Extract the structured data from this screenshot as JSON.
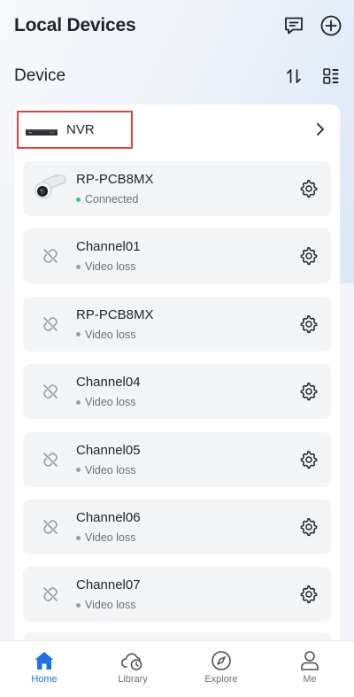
{
  "header": {
    "title": "Local Devices",
    "message_icon": "message-icon",
    "add_icon": "plus-circle-icon"
  },
  "section": {
    "title": "Device",
    "sort_icon": "sort-icon",
    "grid_icon": "grid-view-icon"
  },
  "nvr": {
    "name": "NVR",
    "icon": "nvr-device-icon",
    "chevron": "chevron-right-icon"
  },
  "channels": [
    {
      "name": "RP-PCB8MX",
      "status": "Connected",
      "thumb": "camera",
      "status_color": "#3cc28a"
    },
    {
      "name": "Channel01",
      "status": "Video loss",
      "thumb": "link-broken",
      "status_color": "#9a9ea5"
    },
    {
      "name": "RP-PCB8MX",
      "status": "Video loss",
      "thumb": "link-broken",
      "status_color": "#9a9ea5"
    },
    {
      "name": "Channel04",
      "status": "Video loss",
      "thumb": "link-broken",
      "status_color": "#9a9ea5"
    },
    {
      "name": "Channel05",
      "status": "Video loss",
      "thumb": "link-broken",
      "status_color": "#9a9ea5"
    },
    {
      "name": "Channel06",
      "status": "Video loss",
      "thumb": "link-broken",
      "status_color": "#9a9ea5"
    },
    {
      "name": "Channel07",
      "status": "Video loss",
      "thumb": "link-broken",
      "status_color": "#9a9ea5"
    }
  ],
  "tabs": [
    {
      "label": "Home",
      "icon": "home-icon",
      "active": true
    },
    {
      "label": "Library",
      "icon": "cloud-clock-icon",
      "active": false
    },
    {
      "label": "Explore",
      "icon": "compass-icon",
      "active": false
    },
    {
      "label": "Me",
      "icon": "person-icon",
      "active": false
    }
  ],
  "colors": {
    "accent": "#1f6fe5",
    "highlight": "#e5403a",
    "connected": "#3cc28a",
    "offline": "#9a9ea5"
  }
}
